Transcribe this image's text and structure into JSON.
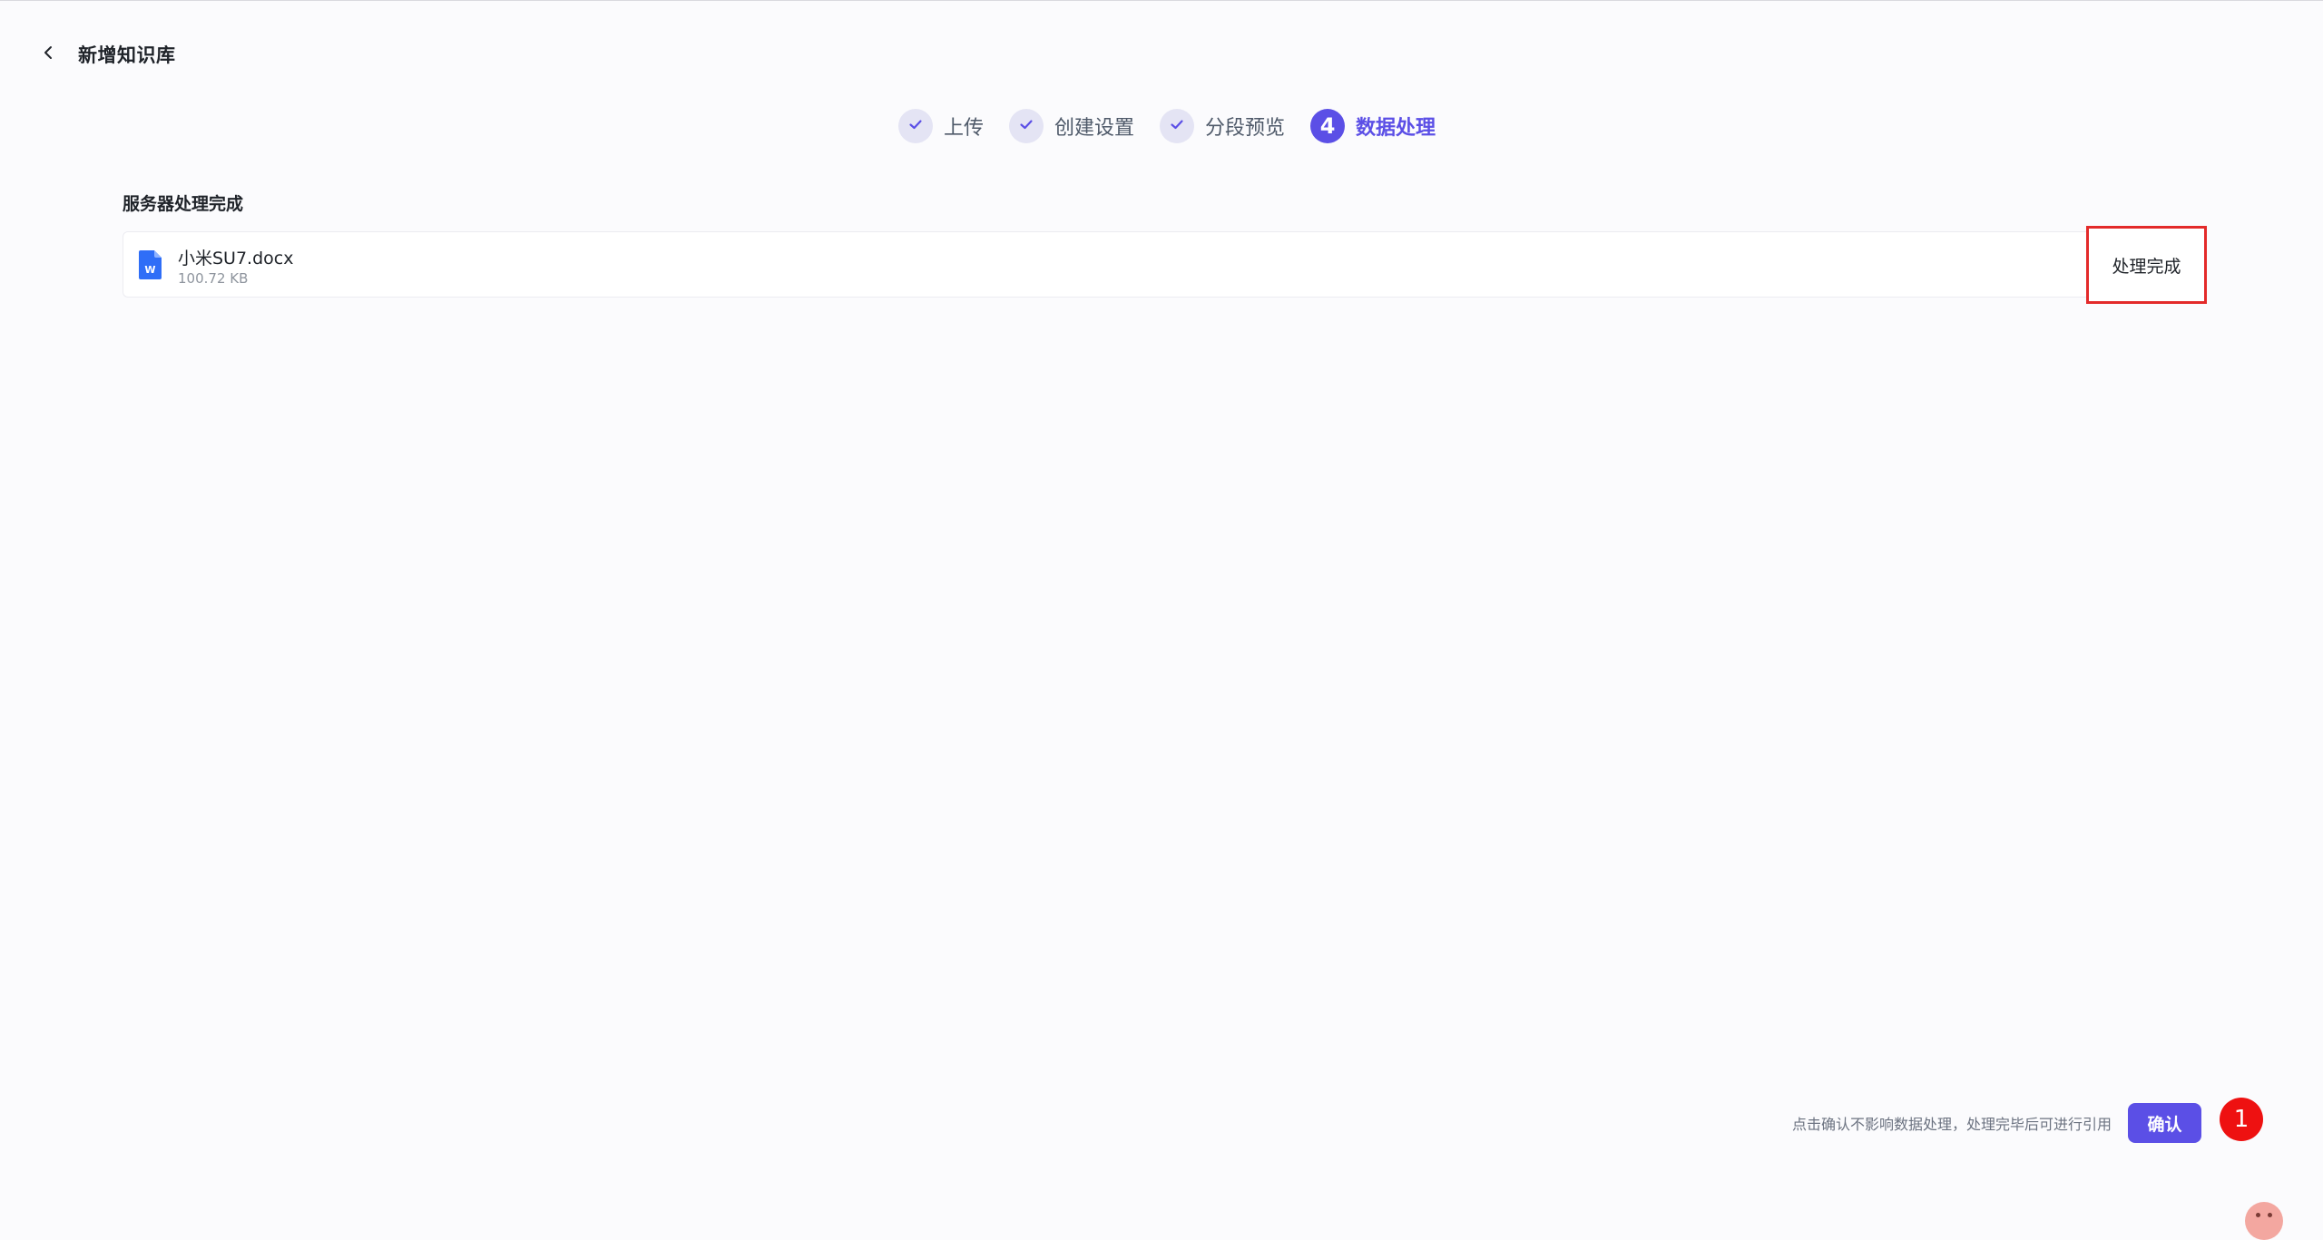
{
  "header": {
    "title": "新增知识库",
    "back_icon": "chevron-left-icon"
  },
  "steps": [
    {
      "label": "上传",
      "state": "done"
    },
    {
      "label": "创建设置",
      "state": "done"
    },
    {
      "label": "分段预览",
      "state": "done"
    },
    {
      "label": "数据处理",
      "state": "active",
      "number": "4"
    }
  ],
  "section": {
    "title": "服务器处理完成"
  },
  "files": [
    {
      "name": "小米SU7.docx",
      "size": "100.72 KB",
      "icon": "word-doc-icon",
      "icon_letter": "W",
      "status": "处理完成"
    }
  ],
  "footer": {
    "hint": "点击确认不影响数据处理，处理完毕后可进行引用",
    "confirm_label": "确认"
  },
  "marker": {
    "label": "1"
  },
  "colors": {
    "accent": "#5b4fe6",
    "highlight_border": "#e32a2a",
    "marker": "#ee1111",
    "doc_icon": "#2f6ef7",
    "background": "#fbfbfd"
  }
}
